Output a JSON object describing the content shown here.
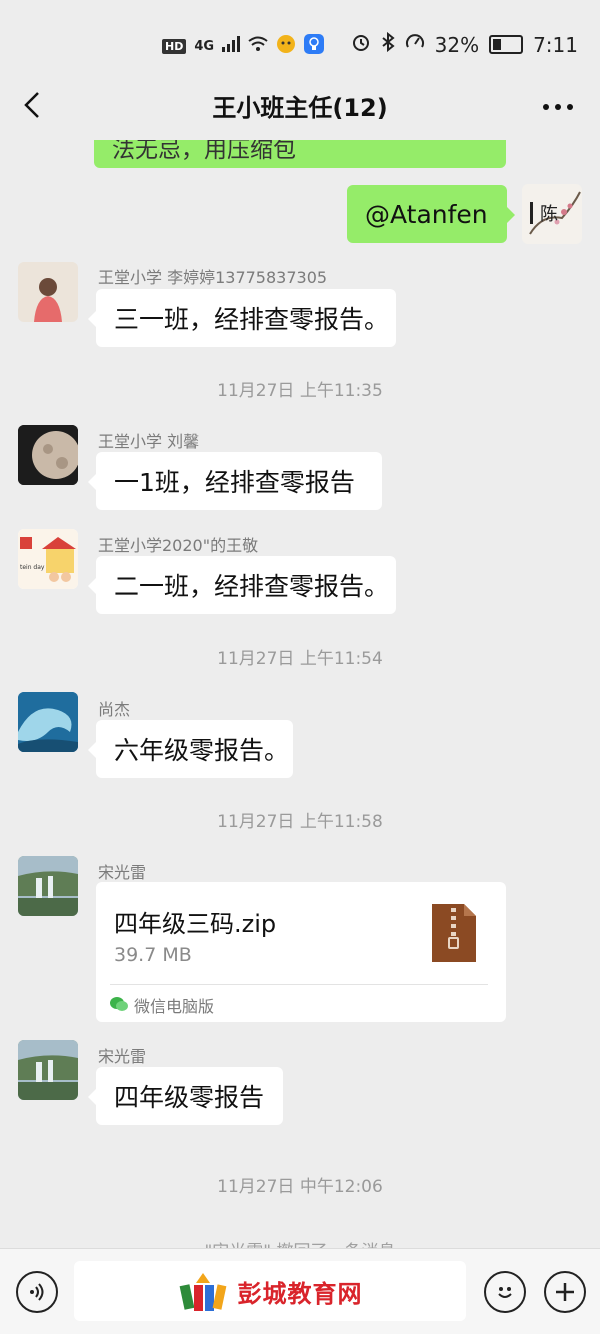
{
  "status_bar": {
    "hd": "HD",
    "network": "4G",
    "battery": "32%",
    "battery_level": 0.32,
    "time": "7:11"
  },
  "header": {
    "title": "王小班主任(12)"
  },
  "messages": {
    "top_partial": "法无忌，用压缩包",
    "mine_mention": "@Atanfen",
    "mine_avatar_char": "陈",
    "m1_sender": "王堂小学 李婷婷13775837305",
    "m1_text": "三一班，经排查零报告。",
    "t1": "11月27日 上午11:35",
    "m2_sender": "王堂小学 刘馨",
    "m2_text": "一1班，经排查零报告",
    "m3_sender": "王堂小学2020\"的王敬",
    "m3_text": "二一班，经排查零报告。",
    "m3_avatar_text": "tein day",
    "t2": "11月27日 上午11:54",
    "m4_sender": "尚杰",
    "m4_text": "六年级零报告。",
    "t3": "11月27日 上午11:58",
    "m5_sender": "宋光雷",
    "file_name": "四年级三码.zip",
    "file_size": "39.7 MB",
    "file_source": "微信电脑版",
    "m6_sender": "宋光雷",
    "m6_text": "四年级零报告",
    "t4": "11月27日 中午12:06",
    "recall": "\"宋光雷\" 撤回了一条消息"
  },
  "input_bar": {
    "watermark": "彭城教育网"
  }
}
